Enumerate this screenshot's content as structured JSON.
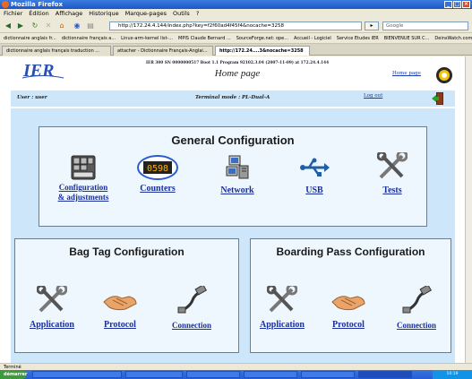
{
  "window": {
    "title": "Mozilla Firefox"
  },
  "menu": [
    "Fichier",
    "Édition",
    "Affichage",
    "Historique",
    "Marque-pages",
    "Outils",
    "?"
  ],
  "nav": {
    "url": "http://172.24.4.144/index.php?key=f2f60ad4f45f4&nocache=3258",
    "search_placeholder": "Google"
  },
  "bookmarks": [
    "dictionnaire anglais fr...",
    "dictionnaire français a...",
    "Linux-arm-kernel list-...",
    "MPIS Claude Bernard ...",
    "SourceForge.net: ope...",
    "Accueil - Logiciel",
    "Service Etudes IER",
    "BIENVENUE SUR C...",
    "DeinsWatch.com: Put..."
  ],
  "tabs": [
    "dictionnaire anglais français traduction ...",
    "attacher - Dictionnaire Français-Anglai...",
    "http://172.24....3&nocache=3258"
  ],
  "header": {
    "info": "IER 300 SN 0000000517 Boot 1.1 Program 92102.3.04 (2007-11-09) at 172.24.4.144",
    "title": "Home page",
    "home_link": "Home page"
  },
  "status": {
    "user": "User : user",
    "terminal": "Terminal mode : PL-Dual-A",
    "logout": "Log out"
  },
  "general": {
    "title": "General Configuration",
    "items": [
      {
        "label": "Configuration\n& adjustments",
        "icon": "control-panel-icon"
      },
      {
        "label": "Counters",
        "icon": "counter-display-icon",
        "counter_value": "0598"
      },
      {
        "label": "Network",
        "icon": "network-computer-icon"
      },
      {
        "label": "USB",
        "icon": "usb-icon"
      },
      {
        "label": "Tests",
        "icon": "tools-icon"
      }
    ]
  },
  "bagtag": {
    "title": "Bag Tag Configuration",
    "items": [
      {
        "label": "Application",
        "icon": "tools-icon"
      },
      {
        "label": "Protocol",
        "icon": "handshake-icon"
      },
      {
        "label": "Connection",
        "icon": "cable-icon"
      }
    ]
  },
  "boarding": {
    "title": "Boarding Pass Configuration",
    "items": [
      {
        "label": "Application",
        "icon": "tools-icon"
      },
      {
        "label": "Protocol",
        "icon": "handshake-icon"
      },
      {
        "label": "Connection",
        "icon": "cable-icon"
      }
    ]
  },
  "statusline": {
    "text": "Terminé"
  },
  "taskbar": {
    "start": "démarrer",
    "clock": "10:19"
  }
}
